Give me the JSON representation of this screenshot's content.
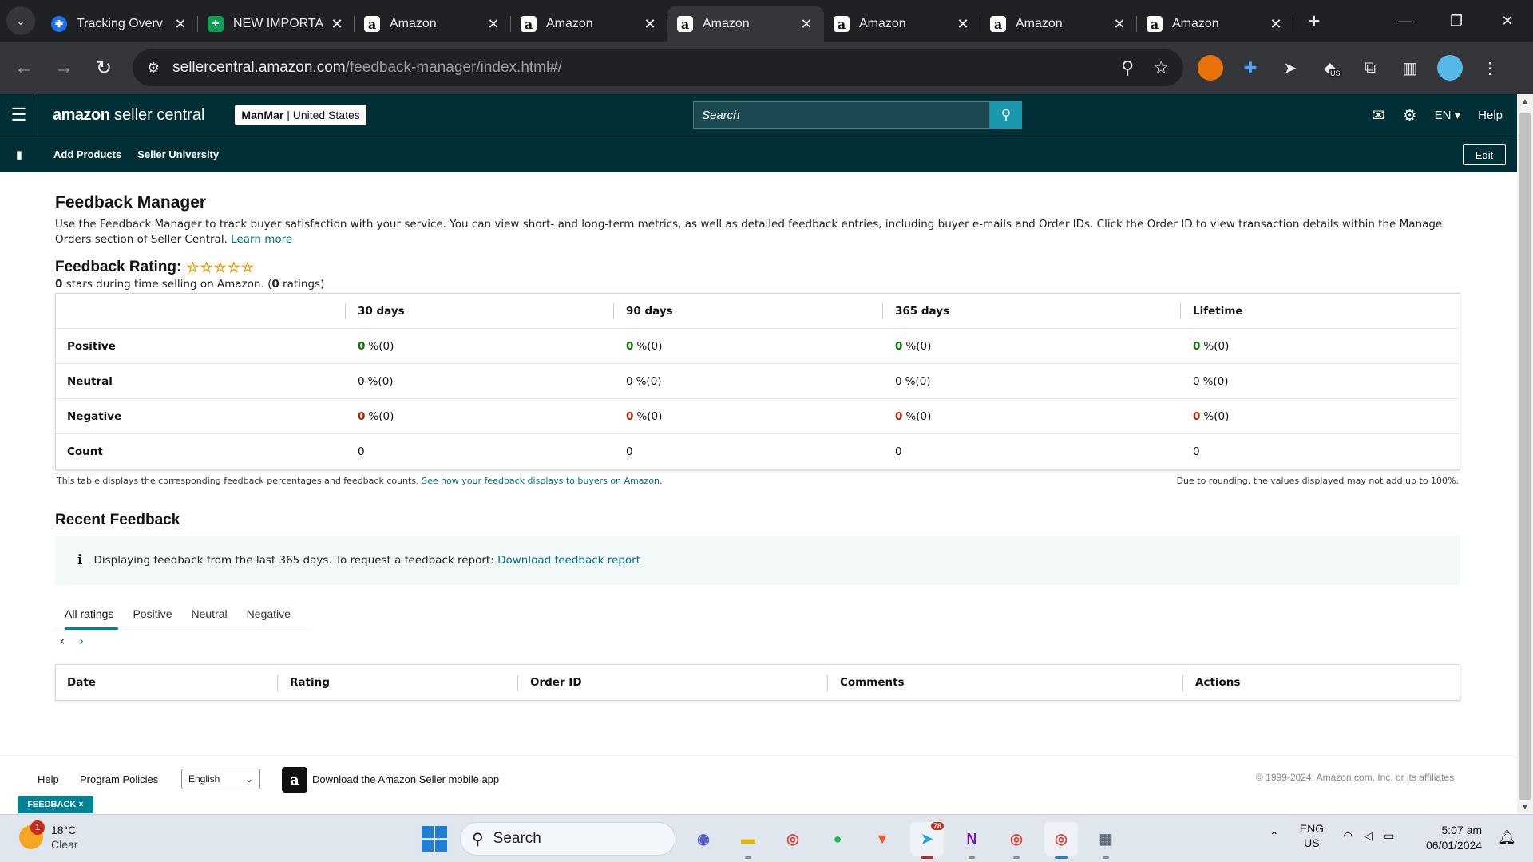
{
  "browser": {
    "tabs": [
      {
        "title": "Tracking Overv",
        "favicon": "tracking-icon",
        "active": false
      },
      {
        "title": "NEW IMPORTA",
        "favicon": "sheets-icon",
        "active": false
      },
      {
        "title": "Amazon",
        "favicon": "amazon-icon",
        "active": false
      },
      {
        "title": "Amazon",
        "favicon": "amazon-icon",
        "active": false
      },
      {
        "title": "Amazon",
        "favicon": "amazon-icon",
        "active": true
      },
      {
        "title": "Amazon",
        "favicon": "amazon-icon",
        "active": false
      },
      {
        "title": "Amazon",
        "favicon": "amazon-icon",
        "active": false
      },
      {
        "title": "Amazon",
        "favicon": "amazon-icon",
        "active": false
      }
    ],
    "url_host": "sellercentral.amazon.com",
    "url_path": "/feedback-manager/index.html#/",
    "extension_badge": "US"
  },
  "header": {
    "logo_bold": "amazon",
    "logo_rest": " seller central",
    "account_name": "ManMar",
    "account_region": " | United States",
    "search_placeholder": "Search",
    "language": "EN",
    "help": "Help"
  },
  "subnav": {
    "add_products": "Add Products",
    "seller_university": "Seller University",
    "edit": "Edit"
  },
  "page": {
    "title": "Feedback Manager",
    "intro": "Use the Feedback Manager to track buyer satisfaction with your service. You can view short- and long-term metrics, as well as detailed feedback entries, including buyer e-mails and Order IDs. Click the Order ID to view transaction details within the Manage Orders section of Seller Central.",
    "learn_more": "Learn more",
    "rating_title": "Feedback Rating:",
    "stars": "☆☆☆☆☆",
    "stars_value": "0",
    "rating_sub_mid": " stars during time selling on Amazon. (",
    "rating_count": "0",
    "rating_sub_end": " ratings)"
  },
  "feedback_table": {
    "columns": [
      "30 days",
      "90 days",
      "365 days",
      "Lifetime"
    ],
    "rows": [
      {
        "label": "Positive",
        "values": [
          "0",
          "0",
          "0",
          "0"
        ],
        "suffix": "%(0)",
        "tone": "green"
      },
      {
        "label": "Neutral",
        "values": [
          "0",
          "0",
          "0",
          "0"
        ],
        "suffix": "%(0)",
        "tone": "plain"
      },
      {
        "label": "Negative",
        "values": [
          "0",
          "0",
          "0",
          "0"
        ],
        "suffix": "%(0)",
        "tone": "red"
      },
      {
        "label": "Count",
        "values": [
          "0",
          "0",
          "0",
          "0"
        ],
        "suffix": "",
        "tone": "count"
      }
    ],
    "note": "This table displays the corresponding feedback percentages and feedback counts.",
    "note_link": "See how your feedback displays to buyers on Amazon.",
    "rounding_note": "Due to rounding, the values displayed may not add up to 100%."
  },
  "recent": {
    "title": "Recent Feedback",
    "info": "Displaying feedback from the last 365 days. To request a feedback report:",
    "info_link": "Download feedback report",
    "tabs": [
      "All ratings",
      "Positive",
      "Neutral",
      "Negative"
    ],
    "active_tab": 0,
    "columns": [
      "Date",
      "Rating",
      "Order ID",
      "Comments",
      "Actions"
    ]
  },
  "footer": {
    "help": "Help",
    "program_policies": "Program Policies",
    "language_select": "English",
    "app_download": "Download the Amazon Seller mobile app",
    "copyright": "© 1999-2024, Amazon.com, Inc. or its affiliates",
    "feedback_badge": "FEEDBACK ×"
  },
  "taskbar": {
    "weather_temp": "18°C",
    "weather_desc": "Clear",
    "weather_alert": "1",
    "search_label": "Search",
    "telegram_badge": "78",
    "lang_top": "ENG",
    "lang_bottom": "US",
    "time": "5:07 am",
    "date": "06/01/2024"
  }
}
